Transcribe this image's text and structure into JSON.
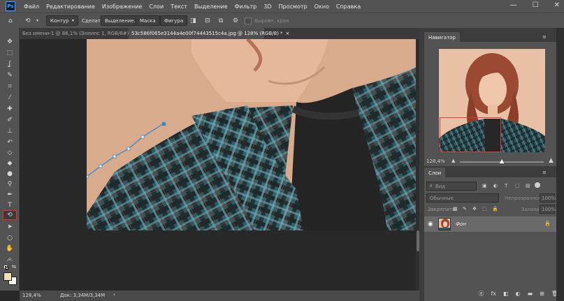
{
  "menu": {
    "app_logo": "Ps",
    "items": [
      "Файл",
      "Редактирование",
      "Изображение",
      "Слои",
      "Текст",
      "Выделение",
      "Фильтр",
      "3D",
      "Просмотр",
      "Окно",
      "Справка"
    ],
    "controls": {
      "minimize": "—",
      "maximize": "☐",
      "close": "✕"
    }
  },
  "options": {
    "mode": "Контур",
    "make_label": "Сделать:",
    "selection_button": "Выделение...",
    "mask_button": "Маска",
    "shape_button": "Фигура",
    "align_edges": "Выровн. края"
  },
  "tabs": [
    {
      "label": "Без имени-1 @ 86,1% (Эллипс 1, RGB/8#) *",
      "close": "×",
      "active": false
    },
    {
      "label": "53c586f065e3144a4e00f74443515c4a.jpg @ 128% (RGB/8) *",
      "close": "×",
      "active": true
    }
  ],
  "toolbar": {
    "tools": [
      {
        "name": "move-tool",
        "icon": "✥",
        "active": false
      },
      {
        "name": "marquee-tool",
        "icon": "⬚",
        "active": false
      },
      {
        "name": "lasso-tool",
        "icon": "ʆ",
        "active": false
      },
      {
        "name": "quick-selection-tool",
        "icon": "✎",
        "active": false
      },
      {
        "name": "crop-tool",
        "icon": "⌗",
        "active": false
      },
      {
        "name": "eyedropper-tool",
        "icon": "⁄",
        "active": false
      },
      {
        "name": "healing-brush-tool",
        "icon": "✚",
        "active": false
      },
      {
        "name": "brush-tool",
        "icon": "✐",
        "active": false
      },
      {
        "name": "clone-stamp-tool",
        "icon": "⊥",
        "active": false
      },
      {
        "name": "history-brush-tool",
        "icon": "↶",
        "active": false
      },
      {
        "name": "eraser-tool",
        "icon": "◇",
        "active": false
      },
      {
        "name": "paint-bucket-tool",
        "icon": "◆",
        "active": false
      },
      {
        "name": "blur-tool",
        "icon": "●",
        "active": false
      },
      {
        "name": "dodge-tool",
        "icon": "⚲",
        "active": false
      },
      {
        "name": "pen-tool",
        "icon": "✒",
        "active": false
      },
      {
        "name": "type-tool",
        "icon": "T",
        "active": false
      },
      {
        "name": "curvature-pen-tool",
        "icon": "⟲",
        "active": true
      },
      {
        "name": "path-selection-tool",
        "icon": "➤",
        "active": false
      },
      {
        "name": "ellipse-tool",
        "icon": "○",
        "active": false
      },
      {
        "name": "hand-tool",
        "icon": "✋",
        "active": false
      },
      {
        "name": "zoom-tool",
        "icon": "⌕",
        "active": false
      },
      {
        "name": "edit-toolbar",
        "icon": "…",
        "active": false
      }
    ],
    "foreground_color": "#f2e0b8",
    "background_color": "#ffffff"
  },
  "status": {
    "zoom": "128,4%",
    "doc": "Док: 3,34M/3,34M",
    "arrow": "›"
  },
  "navigator": {
    "title": "Навигатор",
    "zoom": "128,4%"
  },
  "layers": {
    "title": "Слои",
    "filter_placeholder": "Вид",
    "blend_mode": "Обычные",
    "opacity_label": "Непрозрачность:",
    "opacity_value": "100%",
    "lock_label": "Закрепить:",
    "fill_label": "Заливка:",
    "fill_value": "100%",
    "layer_name": "Фон",
    "bottom_icons": [
      "ⓖ",
      "fx",
      "◧",
      "◐",
      "▬",
      "⊞",
      "🗑"
    ]
  },
  "colors": {
    "accent_red": "#e03030",
    "path_blue": "#2b8ad6",
    "ui_dark": "#535353"
  }
}
